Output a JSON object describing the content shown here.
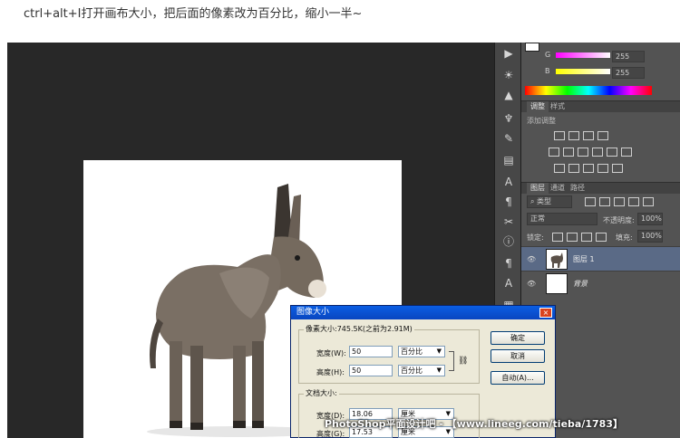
{
  "caption": "ctrl+alt+I打开画布大小，把后面的像素改为百分比，缩小一半~",
  "color_panel": {
    "g_label": "G",
    "g_value": "255",
    "b_label": "B",
    "b_value": "255"
  },
  "adjustments": {
    "tabs": [
      "调整",
      "样式"
    ],
    "subtitle": "添加调整"
  },
  "layers": {
    "tabs": [
      "图层",
      "通道",
      "路径"
    ],
    "kind": "类型",
    "blend_mode": "正常",
    "opacity_label": "不透明度:",
    "opacity_value": "100%",
    "lock_label": "锁定:",
    "fill_label": "填充:",
    "fill_value": "100%",
    "items": [
      {
        "name": "图层 1",
        "selected": true
      },
      {
        "name": "背景",
        "selected": false
      }
    ]
  },
  "dialog": {
    "title": "图像大小",
    "pixel_group_label": "像素大小:745.5K(之前为2.91M)",
    "width_label": "宽度(W):",
    "width_value": "50",
    "width_unit": "百分比",
    "height_label": "高度(H):",
    "height_value": "50",
    "height_unit": "百分比",
    "doc_group_label": "文档大小:",
    "doc_width_label": "宽度(D):",
    "doc_width_value": "18.06",
    "doc_width_unit": "厘米",
    "doc_height_label": "高度(G):",
    "doc_height_value": "17.53",
    "doc_height_unit": "厘米",
    "ok_label": "确定",
    "cancel_label": "取消",
    "auto_label": "自动(A)..."
  },
  "watermark": "PhotoShop平面设计吧 - 【www.lineeg.com/tieba/1783】"
}
